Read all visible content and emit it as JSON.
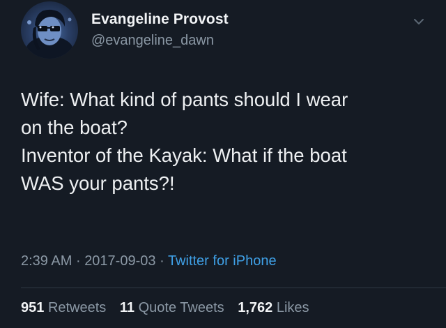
{
  "user": {
    "display_name": "Evangeline Provost",
    "handle": "@evangeline_dawn"
  },
  "icons": {
    "menu": "chevron-down-icon"
  },
  "tweet": {
    "lines": [
      "Wife: What kind of pants should I wear",
      "on the boat?",
      "Inventor of the Kayak: What if the boat",
      "WAS your pants?!"
    ]
  },
  "meta": {
    "time": "2:39 AM",
    "separator": "·",
    "date": "2017-09-03",
    "source": "Twitter for iPhone"
  },
  "stats": {
    "retweets_count": "951",
    "retweets_label": "Retweets",
    "quotes_count": "11",
    "quotes_label": "Quote Tweets",
    "likes_count": "1,762",
    "likes_label": "Likes"
  },
  "colors": {
    "background": "#151b24",
    "link": "#3fa0e6",
    "muted": "#8b98a5"
  }
}
